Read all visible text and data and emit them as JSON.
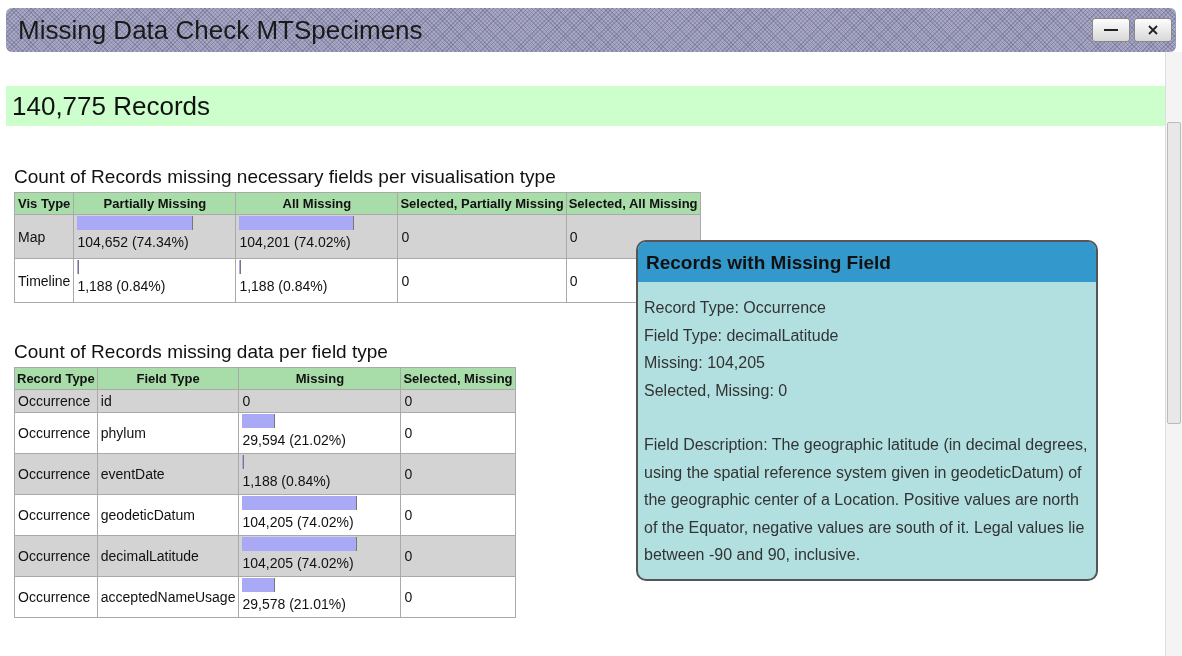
{
  "window": {
    "title": "Missing Data Check MTSpecimens"
  },
  "total": "140,775 Records",
  "vis_section": {
    "heading": "Count of Records missing necessary fields per visualisation type",
    "columns": [
      "Vis Type",
      "Partially Missing",
      "All Missing",
      "Selected, Partially Missing",
      "Selected, All Missing"
    ],
    "rows": [
      {
        "vis_type": "Map",
        "partial": {
          "text": "104,652 (74.34%)",
          "level": 0.7434
        },
        "all": {
          "text": "104,201 (74.02%)",
          "level": 0.7402
        },
        "selected_partial": "0",
        "selected_all": "0"
      },
      {
        "vis_type": "Timeline",
        "partial": {
          "text": "1,188 (0.84%)",
          "level": 0.0084
        },
        "all": {
          "text": "1,188 (0.84%)",
          "level": 0.0084
        },
        "selected_partial": "0",
        "selected_all": "0"
      }
    ]
  },
  "field_section": {
    "heading": "Count of Records missing data per field type",
    "columns": [
      "Record Type",
      "Field Type",
      "Missing",
      "Selected, Missing"
    ],
    "rows": [
      {
        "record_type": "Occurrence",
        "field_type": "id",
        "missing": {
          "text": "0"
        },
        "selected_missing": "0"
      },
      {
        "record_type": "Occurrence",
        "field_type": "phylum",
        "missing": {
          "text": "29,594 (21.02%)",
          "level": 0.2102
        },
        "selected_missing": "0"
      },
      {
        "record_type": "Occurrence",
        "field_type": "eventDate",
        "missing": {
          "text": "1,188 (0.84%)",
          "level": 0.0084
        },
        "selected_missing": "0"
      },
      {
        "record_type": "Occurrence",
        "field_type": "geodeticDatum",
        "missing": {
          "text": "104,205 (74.02%)",
          "level": 0.7402
        },
        "selected_missing": "0"
      },
      {
        "record_type": "Occurrence",
        "field_type": "decimalLatitude",
        "missing": {
          "text": "104,205 (74.02%)",
          "level": 0.7402
        },
        "selected_missing": "0"
      },
      {
        "record_type": "Occurrence",
        "field_type": "acceptedNameUsage",
        "missing": {
          "text": "29,578 (21.01%)",
          "level": 0.2101
        },
        "selected_missing": "0"
      }
    ]
  },
  "tooltip": {
    "title": "Records with Missing Field",
    "lines": [
      "Record Type: Occurrence",
      "Field Type: decimalLatitude",
      "Missing: 104,205",
      "Selected, Missing: 0"
    ],
    "description": "Field Description: The geographic latitude (in decimal degrees, using the spatial reference system given in geodeticDatum) of the geographic center of a Location. Positive values are north of the Equator, negative values are south of it. Legal values lie between -90 and 90, inclusive."
  }
}
